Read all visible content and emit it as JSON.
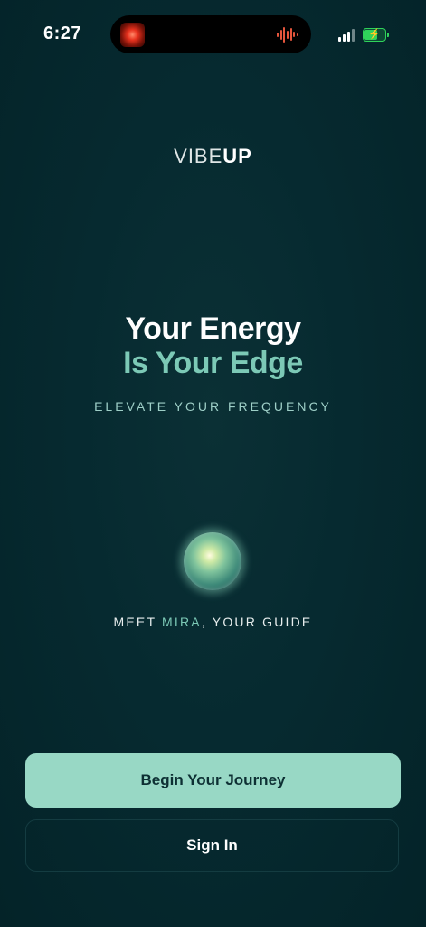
{
  "status_bar": {
    "time": "6:27",
    "icons": [
      "app-recording-icon",
      "audio-wave-icon",
      "signal-icon",
      "battery-charging-icon"
    ],
    "battery_color": "#2fd35a"
  },
  "brand": {
    "logo_light": "VIBE",
    "logo_bold": "UP"
  },
  "hero": {
    "line1": "Your Energy",
    "line2": "Is Your Edge",
    "tagline": "ELEVATE YOUR FREQUENCY"
  },
  "guide": {
    "prefix": "MEET ",
    "name": "MIRA",
    "suffix": ", YOUR GUIDE",
    "icon": "guide-orb-icon"
  },
  "actions": {
    "primary_label": "Begin Your Journey",
    "secondary_label": "Sign In"
  },
  "colors": {
    "background": "#05252b",
    "accent": "#7cc9b6",
    "primary_button": "#98d8c5"
  }
}
